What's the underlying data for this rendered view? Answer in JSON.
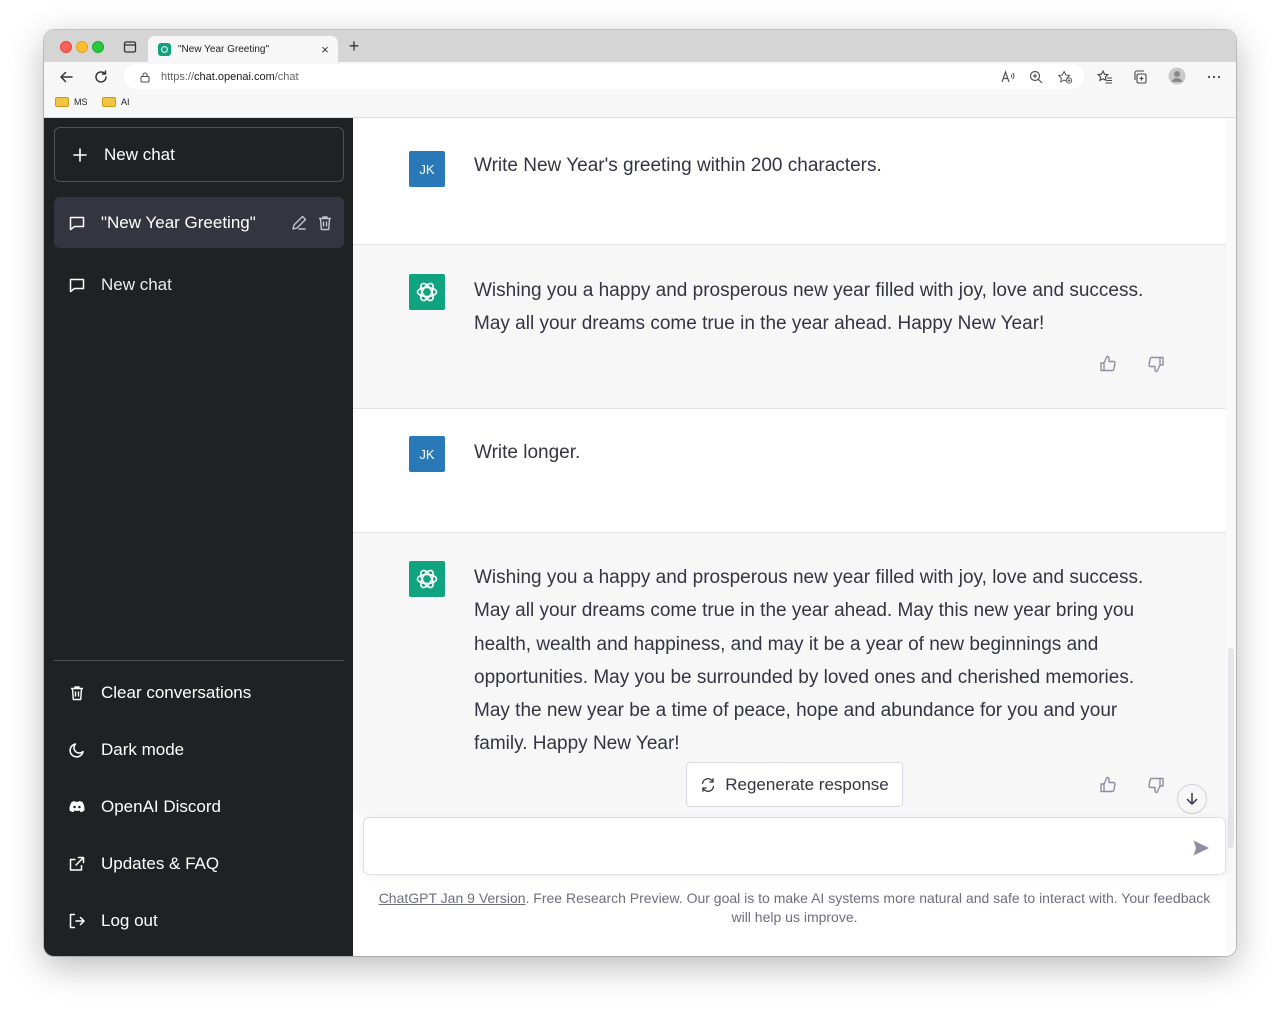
{
  "browser": {
    "tab_title": "\"New Year Greeting\"",
    "tab_close": "×",
    "new_tab": "+",
    "url_scheme": "https://",
    "url_host": "chat.openai.com",
    "url_path": "/chat",
    "bookmarks": [
      {
        "label": "MS"
      },
      {
        "label": "AI"
      }
    ]
  },
  "sidebar": {
    "new_chat_label": "New chat",
    "conversations": [
      {
        "label": "\"New Year Greeting\"",
        "active": true
      },
      {
        "label": "New chat",
        "active": false
      }
    ],
    "links": {
      "clear": "Clear conversations",
      "dark_mode": "Dark mode",
      "discord": "OpenAI Discord",
      "updates": "Updates & FAQ",
      "logout": "Log out"
    }
  },
  "messages": [
    {
      "role": "user",
      "avatar": "JK",
      "text": "Write New Year's greeting within 200 characters."
    },
    {
      "role": "assistant",
      "text": "Wishing you a happy and prosperous new year filled with joy, love and success. May all your dreams come true in the year ahead. Happy New Year!"
    },
    {
      "role": "user",
      "avatar": "JK",
      "text": "Write longer."
    },
    {
      "role": "assistant",
      "text": "Wishing you a happy and prosperous new year filled with joy, love and success. May all your dreams come true in the year ahead. May this new year bring you health, wealth and happiness, and may it be a year of new beginnings and opportunities. May you be surrounded by loved ones and cherished memories. May the new year be a time of peace, hope and abundance for you and your family. Happy New Year!"
    }
  ],
  "composer": {
    "regenerate_label": "Regenerate response",
    "input_value": ""
  },
  "footer": {
    "version_link": "ChatGPT Jan 9 Version",
    "note": ". Free Research Preview. Our goal is to make AI systems more natural and safe to interact with. Your feedback will help us improve."
  },
  "colors": {
    "sidebar_bg": "#202123",
    "active_item_bg": "#343541",
    "user_avatar": "#2979b8",
    "assistant_avatar": "#10a37f",
    "assistant_row_bg": "#f7f7f8"
  }
}
